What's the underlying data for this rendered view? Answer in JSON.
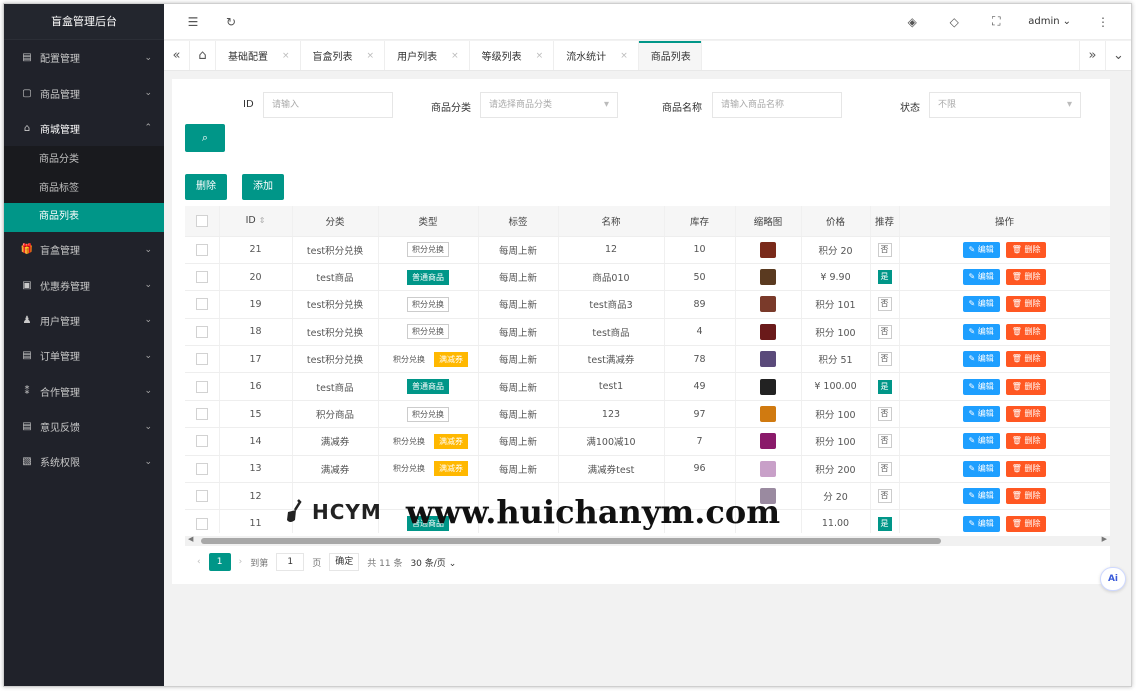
{
  "brand": "盲盒管理后台",
  "sidebar": {
    "items": [
      {
        "icon": "▤",
        "label": "配置管理",
        "arrow": "⌄"
      },
      {
        "icon": "▢",
        "label": "商品管理",
        "arrow": "⌄"
      },
      {
        "icon": "⌂",
        "label": "商城管理",
        "arrow": "⌃"
      },
      {
        "icon": "🎁",
        "label": "盲盒管理",
        "arrow": "⌄"
      },
      {
        "icon": "▣",
        "label": "优惠券管理",
        "arrow": "⌄"
      },
      {
        "icon": "♟",
        "label": "用户管理",
        "arrow": "⌄"
      },
      {
        "icon": "▤",
        "label": "订单管理",
        "arrow": "⌄"
      },
      {
        "icon": "⁑",
        "label": "合作管理",
        "arrow": "⌄"
      },
      {
        "icon": "▤",
        "label": "意见反馈",
        "arrow": "⌄"
      },
      {
        "icon": "▧",
        "label": "系统权限",
        "arrow": "⌄"
      }
    ],
    "sub_items": [
      "商品分类",
      "商品标签",
      "商品列表"
    ]
  },
  "header": {
    "menu_icon": "☰",
    "refresh_icon": "↻",
    "theme_icon": "◈",
    "tag_icon": "◇",
    "fullscreen_icon": "⛶",
    "user": "admin",
    "user_arrow": "⌄",
    "more_icon": "⋮"
  },
  "tabs": {
    "prev": "«",
    "home": "⌂",
    "items": [
      "基础配置",
      "盲盒列表",
      "用户列表",
      "等级列表",
      "流水统计",
      "商品列表"
    ],
    "close": "×",
    "next": "»",
    "menu": "⌄"
  },
  "search": {
    "id_label": "ID",
    "id_placeholder": "请输入",
    "category_label": "商品分类",
    "category_placeholder": "请选择商品分类",
    "name_label": "商品名称",
    "name_placeholder": "请输入商品名称",
    "status_label": "状态",
    "status_value": "不限",
    "search_icon": "⌕"
  },
  "actions": {
    "delete": "删除",
    "add": "添加"
  },
  "table": {
    "headers": [
      "ID",
      "分类",
      "类型",
      "标签",
      "名称",
      "库存",
      "缩略图",
      "价格",
      "推荐",
      "操作"
    ],
    "sort_icon": "⇕",
    "edit_label": "✎ 编辑",
    "delete_label": "🗑 删除",
    "rows": [
      {
        "id": "21",
        "category": "test积分兑换",
        "type1": "积分兑换",
        "type1_style": "plain",
        "type2": "",
        "tag": "每周上新",
        "name": "12",
        "stock": "10",
        "thumb_color": "#7a2a1a",
        "price": "积分 20",
        "rec": "否"
      },
      {
        "id": "20",
        "category": "test商品",
        "type1": "普通商品",
        "type1_style": "green",
        "type2": "",
        "tag": "每周上新",
        "name": "商品010",
        "stock": "50",
        "thumb_color": "#5a3a20",
        "price": "¥ 9.90",
        "rec": "是"
      },
      {
        "id": "19",
        "category": "test积分兑换",
        "type1": "积分兑换",
        "type1_style": "plain",
        "type2": "",
        "tag": "每周上新",
        "name": "test商品3",
        "stock": "89",
        "thumb_color": "#7a3a2a",
        "price": "积分 101",
        "rec": "否"
      },
      {
        "id": "18",
        "category": "test积分兑换",
        "type1": "积分兑换",
        "type1_style": "plain",
        "type2": "",
        "tag": "每周上新",
        "name": "test商品",
        "stock": "4",
        "thumb_color": "#6a1a1a",
        "price": "积分 100",
        "rec": "否"
      },
      {
        "id": "17",
        "category": "test积分兑换",
        "type1": "积分兑换",
        "type1_style": "noborder",
        "type2": "满减券",
        "tag": "每周上新",
        "name": "test满减券",
        "stock": "78",
        "thumb_color": "#5a4a7a",
        "price": "积分 51",
        "rec": "否"
      },
      {
        "id": "16",
        "category": "test商品",
        "type1": "普通商品",
        "type1_style": "green",
        "type2": "",
        "tag": "每周上新",
        "name": "test1",
        "stock": "49",
        "thumb_color": "#222222",
        "price": "¥ 100.00",
        "rec": "是"
      },
      {
        "id": "15",
        "category": "积分商品",
        "type1": "积分兑换",
        "type1_style": "plain",
        "type2": "",
        "tag": "每周上新",
        "name": "123",
        "stock": "97",
        "thumb_color": "#d07a10",
        "price": "积分 100",
        "rec": "否"
      },
      {
        "id": "14",
        "category": "满减券",
        "type1": "积分兑换",
        "type1_style": "noborder",
        "type2": "满减券",
        "tag": "每周上新",
        "name": "满100减10",
        "stock": "7",
        "thumb_color": "#8a1a6a",
        "price": "积分 100",
        "rec": "否"
      },
      {
        "id": "13",
        "category": "满减券",
        "type1": "积分兑换",
        "type1_style": "noborder",
        "type2": "满减券",
        "tag": "每周上新",
        "name": "满减券test",
        "stock": "96",
        "thumb_color": "#c8a0c8",
        "price": "积分 200",
        "rec": "否"
      },
      {
        "id": "12",
        "category": "",
        "type1": "",
        "type1_style": "noborder",
        "type2": "",
        "tag": "",
        "name": "",
        "stock": "",
        "thumb_color": "#9a8aa0",
        "price": "分 20",
        "rec": "否"
      },
      {
        "id": "11",
        "category": "",
        "type1": "普通商品",
        "type1_style": "green",
        "type2": "",
        "tag": "",
        "name": "",
        "stock": "",
        "thumb_color": "#ffffff",
        "price": "11.00",
        "rec": "是"
      }
    ]
  },
  "pager": {
    "prev": "‹",
    "current": "1",
    "next": "›",
    "goto_label": "到第",
    "goto_value": "1",
    "page_unit": "页",
    "confirm": "确定",
    "total": "共 11 条",
    "per_page": "30 条/页",
    "per_page_arrow": "⌄"
  },
  "watermark": {
    "logo": "HCYM",
    "url": "www.huichanym.com"
  },
  "ai_label": "Ai",
  "colors": {
    "primary": "#009688",
    "edit": "#1e9fff",
    "danger": "#ff5722",
    "warn": "#ffb800",
    "sidebar": "#20222a"
  }
}
